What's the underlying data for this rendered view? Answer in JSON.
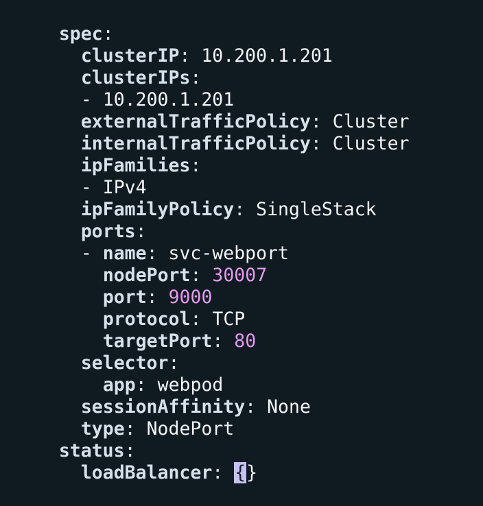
{
  "window": {
    "title": ""
  },
  "yaml": {
    "spec": {
      "key": "spec",
      "clusterIP": {
        "key": "clusterIP",
        "value": "10.200.1.201"
      },
      "clusterIPs": {
        "key": "clusterIPs",
        "items": [
          "10.200.1.201"
        ]
      },
      "externalTrafficPolicy": {
        "key": "externalTrafficPolicy",
        "value": "Cluster"
      },
      "internalTrafficPolicy": {
        "key": "internalTrafficPolicy",
        "value": "Cluster"
      },
      "ipFamilies": {
        "key": "ipFamilies",
        "items": [
          "IPv4"
        ]
      },
      "ipFamilyPolicy": {
        "key": "ipFamilyPolicy",
        "value": "SingleStack"
      },
      "ports": {
        "key": "ports",
        "entries": [
          {
            "name": {
              "key": "name",
              "value": "svc-webport"
            },
            "nodePort": {
              "key": "nodePort",
              "value": "30007"
            },
            "port": {
              "key": "port",
              "value": "9000"
            },
            "protocol": {
              "key": "protocol",
              "value": "TCP"
            },
            "targetPort": {
              "key": "targetPort",
              "value": "80"
            }
          }
        ]
      },
      "selector": {
        "key": "selector",
        "app": {
          "key": "app",
          "value": "webpod"
        }
      },
      "sessionAffinity": {
        "key": "sessionAffinity",
        "value": "None"
      },
      "type": {
        "key": "type",
        "value": "NodePort"
      }
    },
    "status": {
      "key": "status",
      "loadBalancer": {
        "key": "loadBalancer",
        "open": "{",
        "close": "}"
      }
    }
  },
  "colors": {
    "background": "#101a21",
    "key": "#d7e1ea",
    "value": "#f2f6f9",
    "number": "#e59af0",
    "cursor": "#c7c1f4"
  }
}
